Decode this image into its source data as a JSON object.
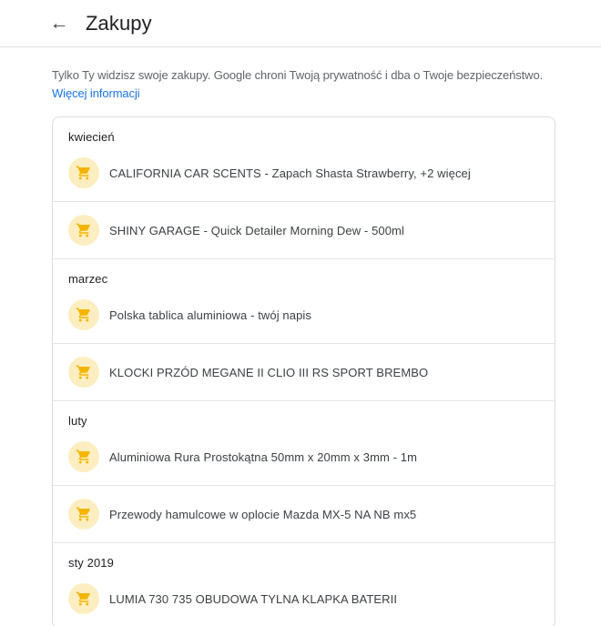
{
  "header": {
    "title": "Zakupy",
    "back_icon": "arrow-left"
  },
  "notice": {
    "text": "Tylko Ty widzisz swoje zakupy. Google chroni Twoją prywatność i dba o Twoje bezpieczeństwo.",
    "link_label": "Więcej informacji"
  },
  "purchases": {
    "item_icon": "shopping-cart",
    "sections": [
      {
        "month": "kwiecień",
        "items": [
          "CALIFORNIA CAR SCENTS - Zapach Shasta Strawberry, +2 więcej",
          "SHINY GARAGE - Quick Detailer Morning Dew - 500ml"
        ]
      },
      {
        "month": "marzec",
        "items": [
          "Polska tablica aluminiowa - twój napis",
          "KLOCKI PRZÓD MEGANE II CLIO III RS SPORT BREMBO"
        ]
      },
      {
        "month": "luty",
        "items": [
          "Aluminiowa Rura Prostokątna 50mm x 20mm x 3mm - 1m",
          "Przewody hamulcowe w oplocie Mazda MX-5 NA NB mx5"
        ]
      },
      {
        "month": "sty 2019",
        "items": [
          "LUMIA 730 735 OBUDOWA TYLNA KLAPKA BATERII"
        ]
      }
    ]
  },
  "colors": {
    "link": "#1a73e8",
    "icon_bg": "#fceec0",
    "icon_fg": "#f5b400",
    "divider": "#e4e4e4",
    "card_border": "#dadce0",
    "header_border": "#e0e0e0",
    "title_text": "#202124",
    "body_text": "#3c4043",
    "muted_text": "#5f6368"
  }
}
